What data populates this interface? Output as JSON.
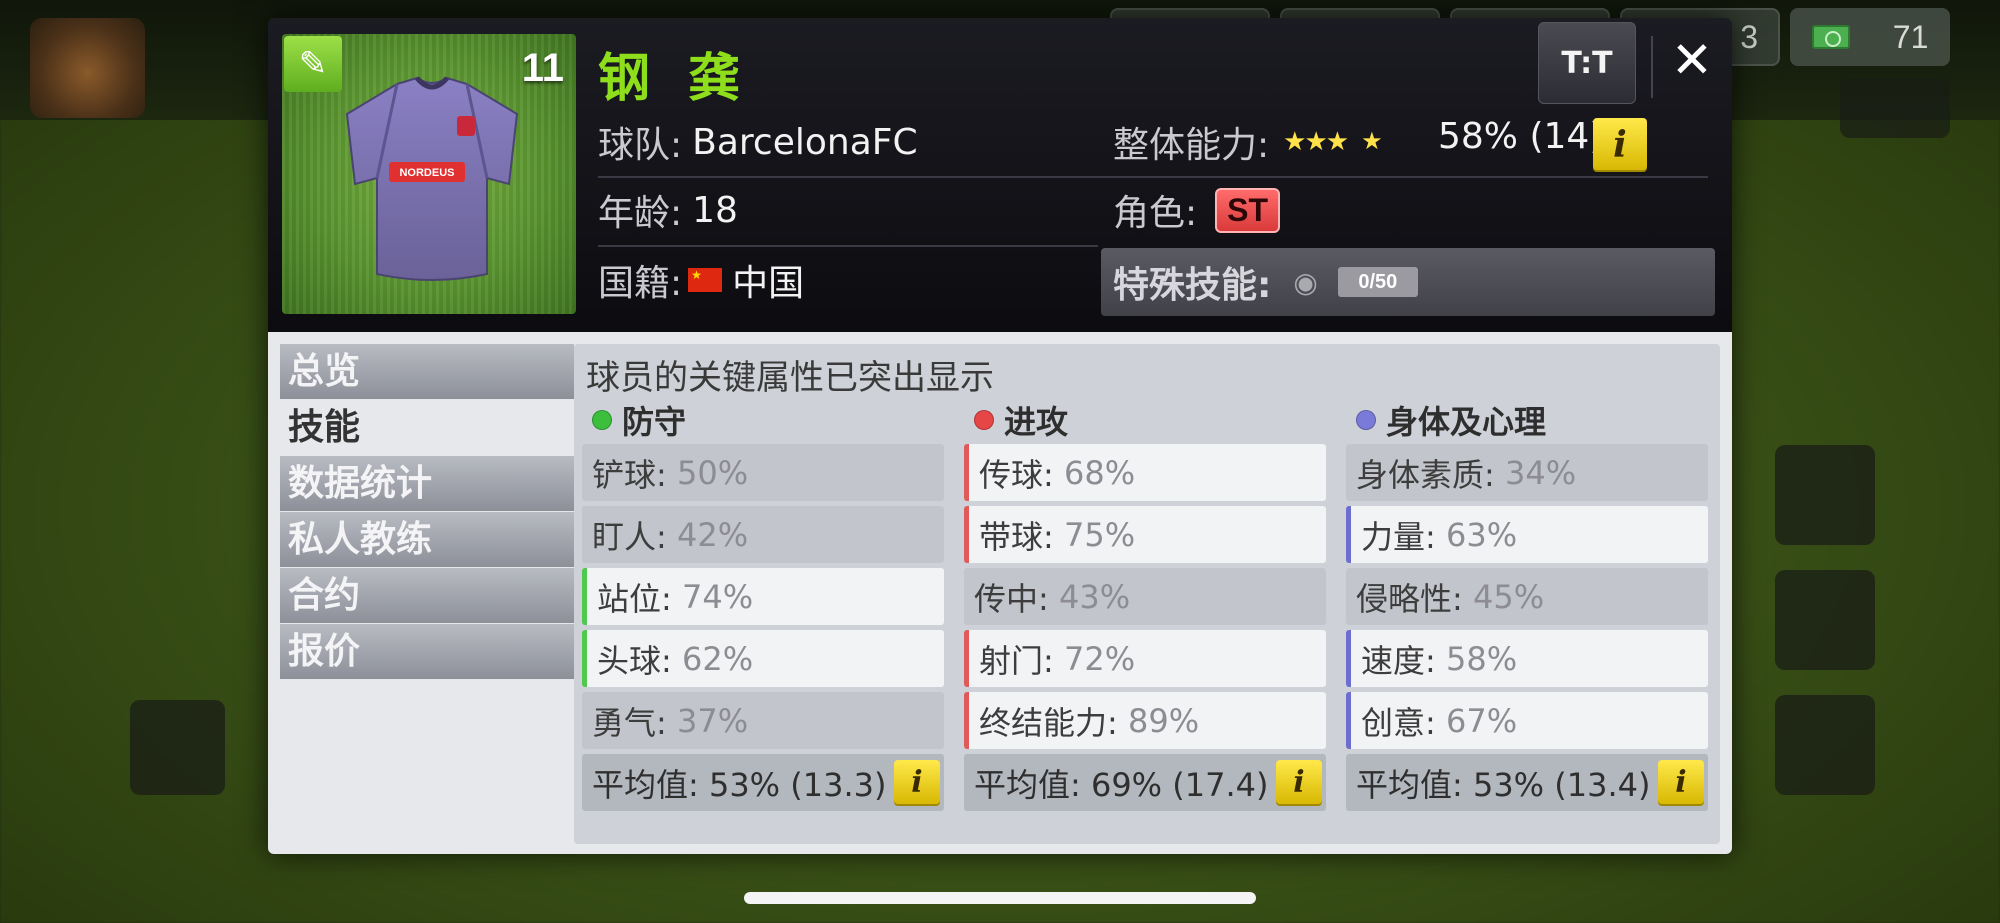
{
  "topbar": {
    "money": "71",
    "partial_counter": "3"
  },
  "player": {
    "name": "钢 龚",
    "number": "11",
    "shirt_sponsor": "NORDEUS",
    "team_label": "球队:",
    "team": "BarcelonaFC",
    "age_label": "年龄:",
    "age": "18",
    "nationality_label": "国籍:",
    "nationality": "中国",
    "overall_label": "整体能力:",
    "overall": "58% (14)",
    "stars": 3.5,
    "role_label": "角色:",
    "role": "ST",
    "special_label": "特殊技能:",
    "special": "0/50"
  },
  "header_buttons": {
    "kit": "T:T",
    "close": "✕",
    "info": "i"
  },
  "tabs": [
    {
      "label": "总览",
      "active": false
    },
    {
      "label": "技能",
      "active": true
    },
    {
      "label": "数据统计",
      "active": false
    },
    {
      "label": "私人教练",
      "active": false
    },
    {
      "label": "合约",
      "active": false
    },
    {
      "label": "报价",
      "active": false
    }
  ],
  "skills": {
    "subtitle": "球员的关键属性已突出显示",
    "columns": [
      {
        "title": "防守",
        "color": "#3cbf3c",
        "accent": "#4ec94e",
        "attributes": [
          {
            "name": "铲球:",
            "value": "50%",
            "key": false
          },
          {
            "name": "盯人:",
            "value": "42%",
            "key": false
          },
          {
            "name": "站位:",
            "value": "74%",
            "key": true
          },
          {
            "name": "头球:",
            "value": "62%",
            "key": true
          },
          {
            "name": "勇气:",
            "value": "37%",
            "key": false
          }
        ],
        "average": "平均值: 53% (13.3)"
      },
      {
        "title": "进攻",
        "color": "#e64646",
        "accent": "#e05a5a",
        "attributes": [
          {
            "name": "传球:",
            "value": "68%",
            "key": true
          },
          {
            "name": "带球:",
            "value": "75%",
            "key": true
          },
          {
            "name": "传中:",
            "value": "43%",
            "key": false
          },
          {
            "name": "射门:",
            "value": "72%",
            "key": true
          },
          {
            "name": "终结能力:",
            "value": "89%",
            "key": true
          }
        ],
        "average": "平均值: 69% (17.4)"
      },
      {
        "title": "身体及心理",
        "color": "#7a7ad8",
        "accent": "#6d6dcf",
        "attributes": [
          {
            "name": "身体素质:",
            "value": "34%",
            "key": false
          },
          {
            "name": "力量:",
            "value": "63%",
            "key": true
          },
          {
            "name": "侵略性:",
            "value": "45%",
            "key": false
          },
          {
            "name": "速度:",
            "value": "58%",
            "key": true
          },
          {
            "name": "创意:",
            "value": "67%",
            "key": true
          }
        ],
        "average": "平均值: 53% (13.4)"
      }
    ]
  }
}
